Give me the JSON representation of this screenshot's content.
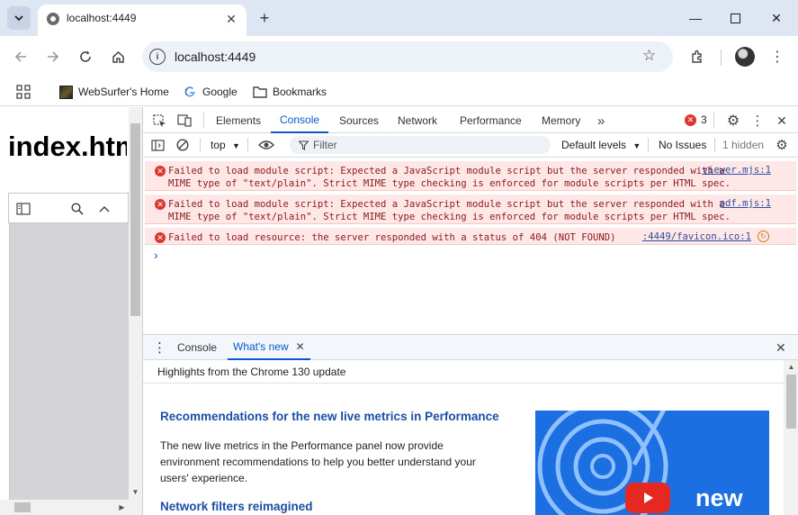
{
  "browser": {
    "tab_title": "localhost:4449",
    "address": "localhost:4449",
    "bookmarks": [
      {
        "label": "WebSurfer's Home",
        "icon": "websurfer-favicon-icon"
      },
      {
        "label": "Google",
        "icon": "google-icon"
      },
      {
        "label": "Bookmarks",
        "icon": "folder-icon"
      }
    ]
  },
  "page": {
    "heading": "index.html"
  },
  "devtools": {
    "tabs": [
      "Elements",
      "Console",
      "Sources",
      "Network",
      "Performance",
      "Memory"
    ],
    "active_tab": "Console",
    "error_count": "3",
    "console_bar": {
      "context": "top",
      "filter_placeholder": "Filter",
      "levels": "Default levels",
      "issues": "No Issues",
      "hidden": "1 hidden"
    },
    "messages": [
      {
        "text": "Failed to load module script: Expected a JavaScript module script but the server responded with a\nMIME type of \"text/plain\". Strict MIME type checking is enforced for module scripts per HTML spec.",
        "source": "viewer.mjs:1"
      },
      {
        "text": "Failed to load module script: Expected a JavaScript module script but the server responded with a\nMIME type of \"text/plain\". Strict MIME type checking is enforced for module scripts per HTML spec.",
        "source": "pdf.mjs:1"
      },
      {
        "text": "Failed to load resource: the server responded with a status of 404 (NOT FOUND)",
        "source": ":4449/favicon.ico:1"
      }
    ],
    "drawer": {
      "tabs": [
        "Console",
        "What's new"
      ],
      "active_tab": "What's new",
      "header": "Highlights from the Chrome 130 update",
      "section1_title": "Recommendations for the new live metrics in Performance",
      "section1_body": "The new live metrics in the Performance panel now provide environment recommendations to help you better understand your users' experience.",
      "section2_title": "Network filters reimagined",
      "image_caption": "new"
    }
  },
  "colors": {
    "accent": "#0b57d0",
    "error_bg": "#fde7e7",
    "error_text": "#8e1a1a",
    "error_icon": "#dc362e",
    "tabstrip": "#dfe6f3"
  }
}
